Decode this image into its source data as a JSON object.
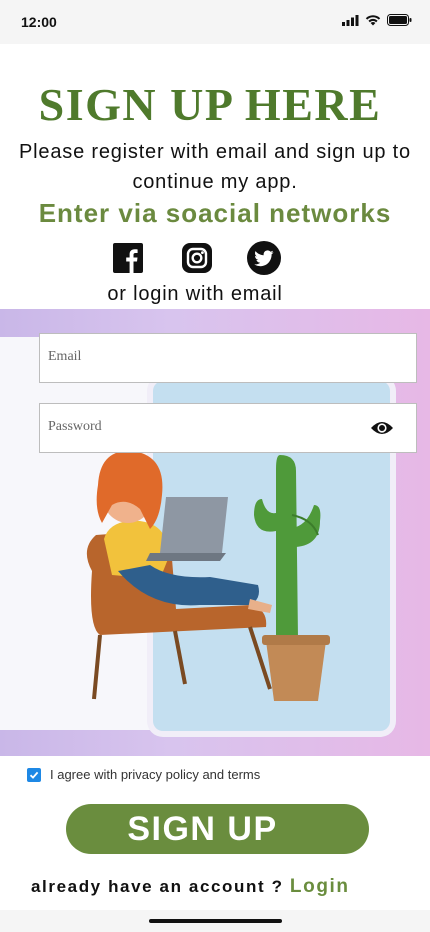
{
  "status_bar": {
    "time": "12:00"
  },
  "header": {
    "title": "SIGN UP HERE",
    "subtitle": "Please register with email and sign up to continue my app.",
    "social_prompt": "Enter via soacial networks",
    "social_icons": [
      "facebook-icon",
      "instagram-icon",
      "twitter-icon"
    ],
    "or_login": "or login with email"
  },
  "form": {
    "email_placeholder": "Email",
    "email_value": "",
    "password_placeholder": "Password",
    "password_value": "",
    "agree_checked": true,
    "agree_label": "I agree with privacy policy and terms",
    "submit_label": "SIGN UP"
  },
  "footer": {
    "account_prompt": "already have an account ?",
    "login_link": "Login"
  },
  "colors": {
    "primary_green": "#6a8d3e",
    "title_green": "#4f7a2c",
    "checkbox_blue": "#1e88e5"
  }
}
